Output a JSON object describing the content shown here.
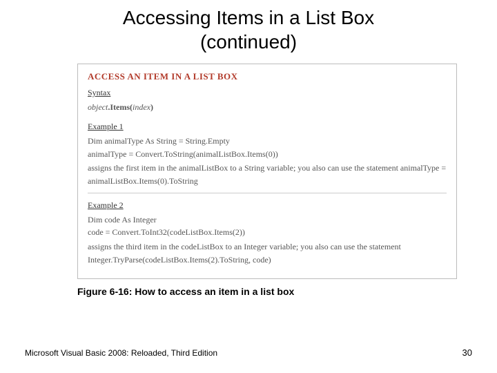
{
  "title_line1": "Accessing Items in a List Box",
  "title_line2": "(continued)",
  "box": {
    "heading": "ACCESS AN ITEM IN A LIST BOX",
    "syntax_label": "Syntax",
    "syntax_obj": "object",
    "syntax_rest": ".Items(",
    "syntax_index": "index",
    "syntax_close": ")",
    "ex1_label": "Example 1",
    "ex1_code1": "Dim animalType As String = String.Empty",
    "ex1_code2": "animalType = Convert.ToString(animalListBox.Items(0))",
    "ex1_desc": "assigns the first item in the animalListBox to a String variable; you also can use the statement animalType = animalListBox.Items(0).ToString",
    "ex2_label": "Example 2",
    "ex2_code1": "Dim code As Integer",
    "ex2_code2": "code = Convert.ToInt32(codeListBox.Items(2))",
    "ex2_desc": "assigns the third item in the codeListBox to an Integer variable; you also can use the statement Integer.TryParse(codeListBox.Items(2).ToString, code)"
  },
  "caption": "Figure 6-16: How to access an item in a list box",
  "footer_left": "Microsoft Visual Basic 2008: Reloaded, Third Edition",
  "footer_right": "30"
}
